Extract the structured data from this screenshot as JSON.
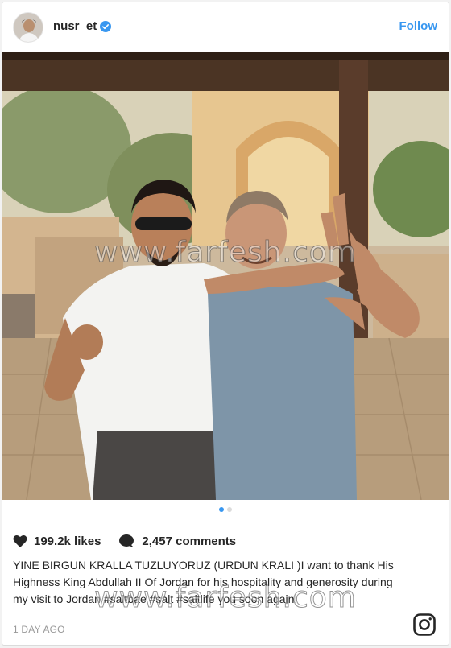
{
  "post": {
    "username": "nusr_et",
    "follow_label": "Follow",
    "likes": "199.2k likes",
    "comments": "2,457 comments",
    "caption": "YINE BIRGUN KRALLA TUZLUYORUZ (URDUN KRALI )I want to thank His Highness King Abdullah II Of Jordan for his hospitality and generosity during my visit to Jordan #saltbae #salt #saltlife you soon again!",
    "timestamp": "1 DAY AGO"
  },
  "carousel": {
    "total": 2,
    "active_index": 0
  },
  "watermark": {
    "text": "www.farfesh.com"
  },
  "colors": {
    "accent": "#3897f0",
    "muted": "#999999",
    "text": "#262626"
  },
  "icons": [
    "avatar",
    "verified-badge-icon",
    "heart-icon",
    "comment-bubble-icon",
    "instagram-logo-icon"
  ]
}
